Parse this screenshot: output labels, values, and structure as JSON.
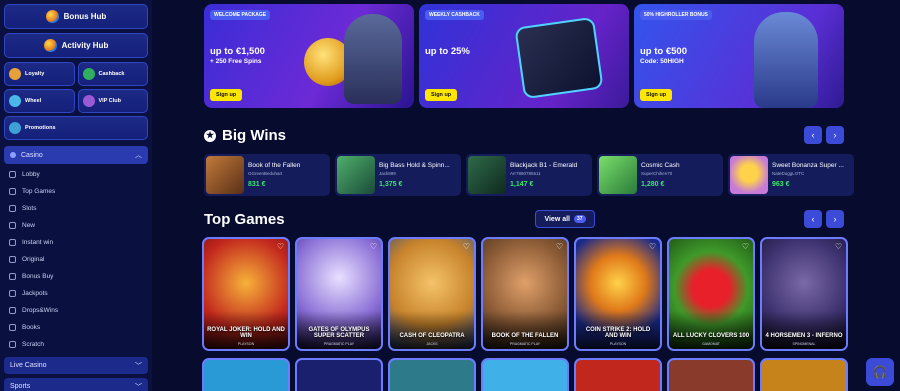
{
  "sidebar": {
    "hubs": [
      {
        "label": "Bonus Hub",
        "icon": "bonus-hub-icon"
      },
      {
        "label": "Activity Hub",
        "icon": "activity-hub-icon"
      }
    ],
    "tiles": [
      {
        "label": "Loyalty",
        "icon": "loyalty-icon",
        "color": "#e8a13a"
      },
      {
        "label": "Cashback",
        "icon": "cashback-icon",
        "color": "#2fb05e"
      },
      {
        "label": "Wheel",
        "icon": "wheel-icon",
        "color": "#4bb6e8"
      },
      {
        "label": "VIP Club",
        "icon": "vip-club-icon",
        "color": "#9b59d6"
      },
      {
        "label": "Promotions",
        "icon": "promotions-icon",
        "color": "#3fa0d8"
      }
    ],
    "casino": {
      "label": "Casino",
      "items": [
        "Lobby",
        "Top Games",
        "Slots",
        "New",
        "Instant win",
        "Original",
        "Bonus Buy",
        "Jackpots",
        "Drops&Wins",
        "Books",
        "Scratch"
      ]
    },
    "live_casino": "Live Casino",
    "sports": "Sports"
  },
  "promos": [
    {
      "tag": "WELCOME PACKAGE",
      "line1": "up to €1,500",
      "line2": "+ 250 Free Spins",
      "button": "Sign up",
      "badge": "BONUS"
    },
    {
      "tag": "WEEKLY CASHBACK",
      "line1": "up to 25%",
      "line2": "",
      "button": "Sign up",
      "badge": "CASH BACK"
    },
    {
      "tag": "50% HIGHROLLER BONUS",
      "line1": "up to €500",
      "line2": "Code: 50HIGH",
      "button": "Sign up",
      "badge": ""
    }
  ],
  "big_wins": {
    "title": "Big Wins",
    "items": [
      {
        "game": "Book of the Fallen",
        "user": "GGreenBeduhart",
        "amount": "831 €",
        "color": "#a0522d"
      },
      {
        "game": "Big Bass Hold & Spinn...",
        "user": "Jack999",
        "amount": "1,375 €",
        "color": "#2e8b57"
      },
      {
        "game": "Blackjack B1 - Emerald",
        "user": "Arr7880785511",
        "amount": "1,147 €",
        "color": "#1f6e4a"
      },
      {
        "game": "Cosmic Cash",
        "user": "SuperChihen70",
        "amount": "1,280 €",
        "color": "#5bd65b"
      },
      {
        "game": "Sweet Bonanza Super ...",
        "user": "NateDoggLOTC",
        "amount": "963 €",
        "color": "#c77ad6"
      }
    ]
  },
  "top_games": {
    "title": "Top Games",
    "view_all": "View all",
    "count": "37",
    "items": [
      {
        "title": "ROYAL JOKER: HOLD AND WIN",
        "provider": "PLAYSON",
        "bg": "#c2271d"
      },
      {
        "title": "GATES OF OLYMPUS SUPER SCATTER",
        "provider": "PRAGMATIC PLAY",
        "bg": "#8a6fd6"
      },
      {
        "title": "CASH OF CLEOPATRA",
        "provider": "JACKS",
        "bg": "#c7832b"
      },
      {
        "title": "BOOK OF THE FALLEN",
        "provider": "PRAGMATIC PLAY",
        "bg": "#8a5a35"
      },
      {
        "title": "COIN STRIKE 2: HOLD AND WIN",
        "provider": "PLAYSON",
        "bg": "#b1261e"
      },
      {
        "title": "ALL LUCKY CLOVERS 100",
        "provider": "GAMOMAT",
        "bg": "#3f9a2a"
      },
      {
        "title": "4 HORSEMEN 3 - INFERNO",
        "provider": "SPINOMENAL",
        "bg": "#3e3270"
      }
    ],
    "second_row_colors": [
      "#2a9ad6",
      "#1a1f6e",
      "#2d7a8a",
      "#3fb0e8",
      "#c2271d",
      "#8a3a2a",
      "#c7831b"
    ]
  },
  "nav_arrows": {
    "prev": "‹",
    "next": "›"
  },
  "support_icon": "headset-icon"
}
